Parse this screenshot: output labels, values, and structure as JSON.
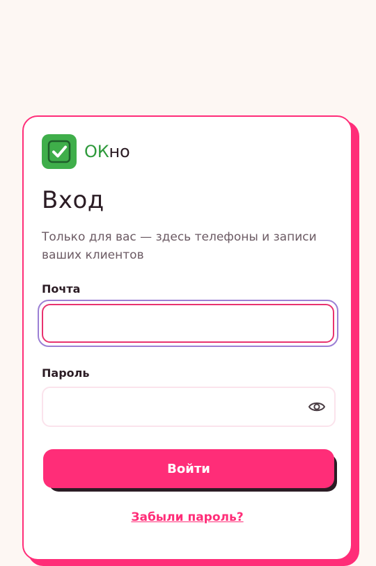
{
  "brand": {
    "name_accent": "ОК",
    "name_rest": "но",
    "logo_icon": "checkbox-check-icon"
  },
  "login": {
    "title": "Вход",
    "subtitle": "Только для вас — здесь телефоны и записи ваших клиентов",
    "email_label": "Почта",
    "email_value": "",
    "password_label": "Пароль",
    "password_value": "",
    "password_toggle_icon": "eye-icon",
    "submit_label": "Войти",
    "forgot_label": "Забыли пароль?"
  },
  "colors": {
    "accent": "#ff2d78",
    "brand_green": "#3fae4a",
    "focus_ring": "#9b7fd4",
    "text_dark": "#2b1c24",
    "background": "#fdf7f3"
  }
}
